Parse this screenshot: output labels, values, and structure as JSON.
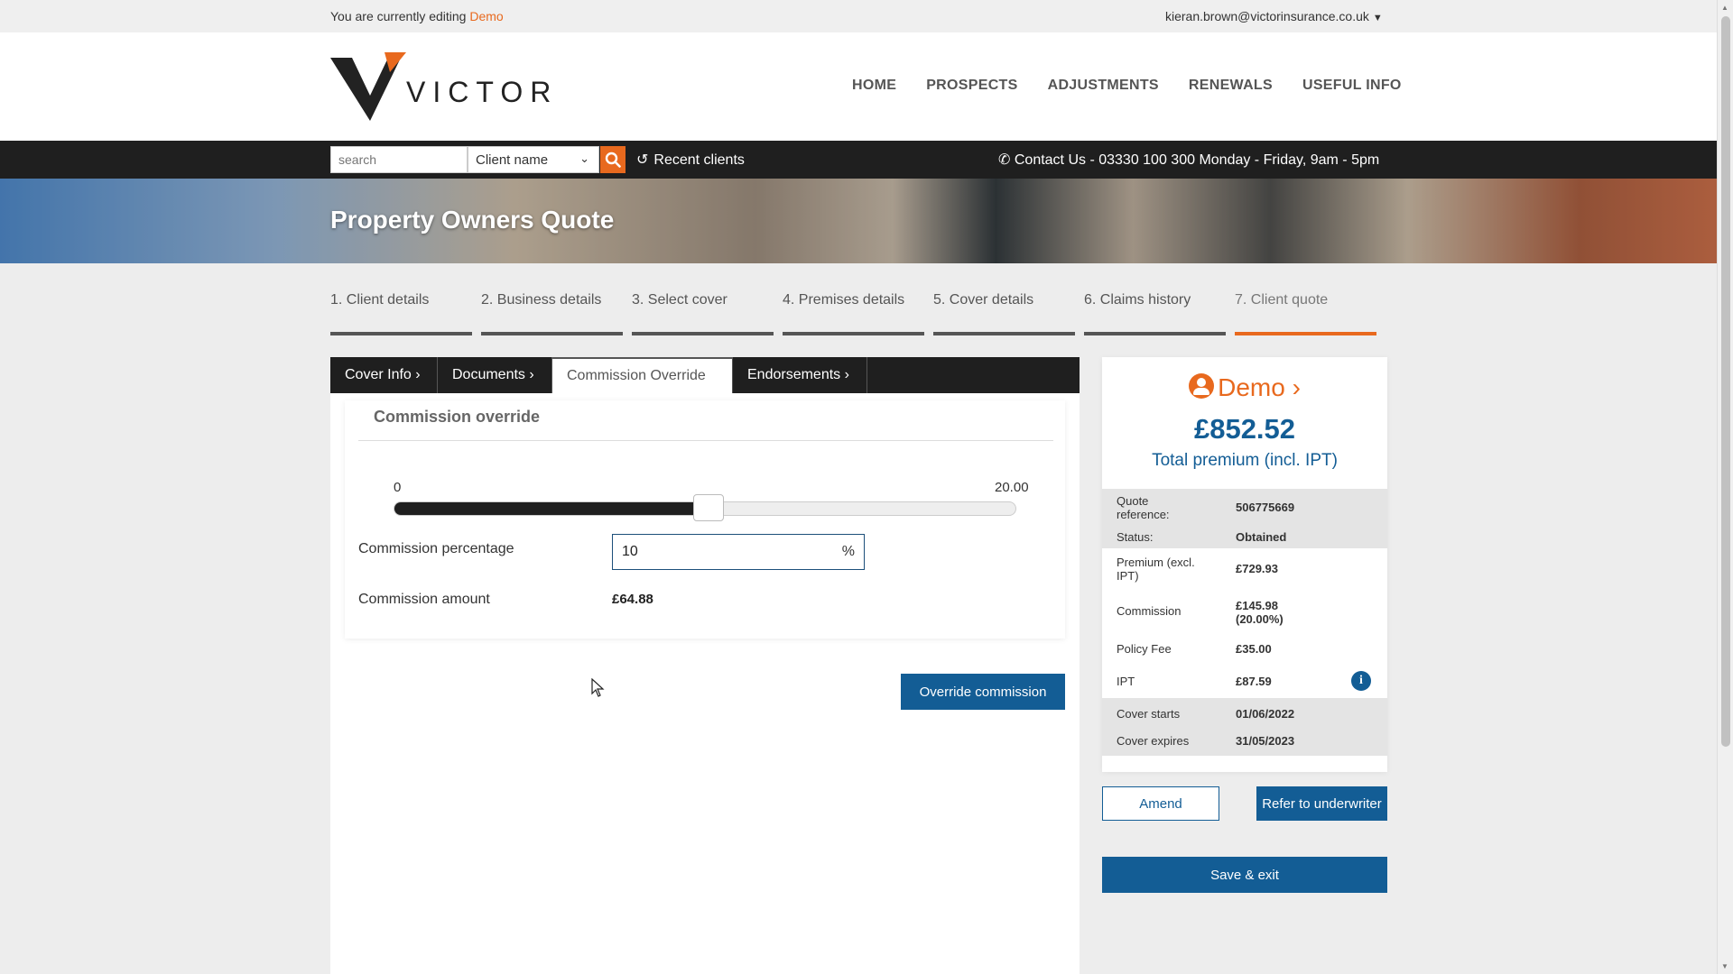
{
  "topbar": {
    "editing_prefix": "You are currently editing",
    "editing_client": "Demo",
    "user_email": "kieran.brown@victorinsurance.co.uk"
  },
  "header": {
    "logo_text": "VICTOR",
    "nav": [
      "HOME",
      "PROSPECTS",
      "ADJUSTMENTS",
      "RENEWALS",
      "USEFUL INFO"
    ]
  },
  "search": {
    "placeholder": "search",
    "select_value": "Client name",
    "recent_label": "Recent clients",
    "contact": "Contact Us - 03330 100 300  Monday - Friday, 9am - 5pm"
  },
  "banner": {
    "title": "Property Owners Quote"
  },
  "steps": [
    "1. Client details",
    "2. Business details",
    "3. Select cover",
    "4. Premises details",
    "5. Cover details",
    "6. Claims history",
    "7. Client quote"
  ],
  "active_step": 6,
  "tabs": [
    {
      "label": "Cover Info",
      "chevron": true
    },
    {
      "label": "Documents",
      "chevron": true
    },
    {
      "label": "Commission Override",
      "chevron": false
    },
    {
      "label": "Endorsements",
      "chevron": true
    }
  ],
  "commission": {
    "heading": "Commission override",
    "slider_min": "0",
    "slider_max": "20.00",
    "slider_value_fraction": 0.5,
    "percentage_label": "Commission percentage",
    "percentage_value": "10",
    "percent_sign": "%",
    "amount_label": "Commission amount",
    "amount_value": "£64.88",
    "override_button": "Override commission"
  },
  "summary": {
    "client": "Demo",
    "premium": "£852.52",
    "premium_label": "Total premium (incl. IPT)",
    "rows": [
      {
        "key": "Quote reference:",
        "value": "506775669",
        "grey": true
      },
      {
        "key": "Status:",
        "value": "Obtained",
        "grey": true
      },
      {
        "key": "Premium (excl. IPT)",
        "value": "£729.93",
        "grey": false
      },
      {
        "key": "Commission",
        "value": "£145.98 (20.00%)",
        "grey": false
      },
      {
        "key": "Policy Fee",
        "value": "£35.00",
        "grey": false
      },
      {
        "key": "IPT",
        "value": "£87.59",
        "grey": false,
        "info": true
      },
      {
        "key": "Cover starts",
        "value": "01/06/2022",
        "grey": true
      },
      {
        "key": "Cover expires",
        "value": "31/05/2023",
        "grey": true
      }
    ],
    "amend_button": "Amend",
    "refer_button": "Refer to underwriter",
    "save_button": "Save & exit"
  },
  "colors": {
    "accent": "#e8691e",
    "primary": "#135d95",
    "dark": "#1f1f1f"
  },
  "icons": [
    "chevron-down-icon",
    "search-icon",
    "history-icon",
    "phone-icon",
    "user-icon",
    "chevron-right-icon",
    "info-icon"
  ]
}
